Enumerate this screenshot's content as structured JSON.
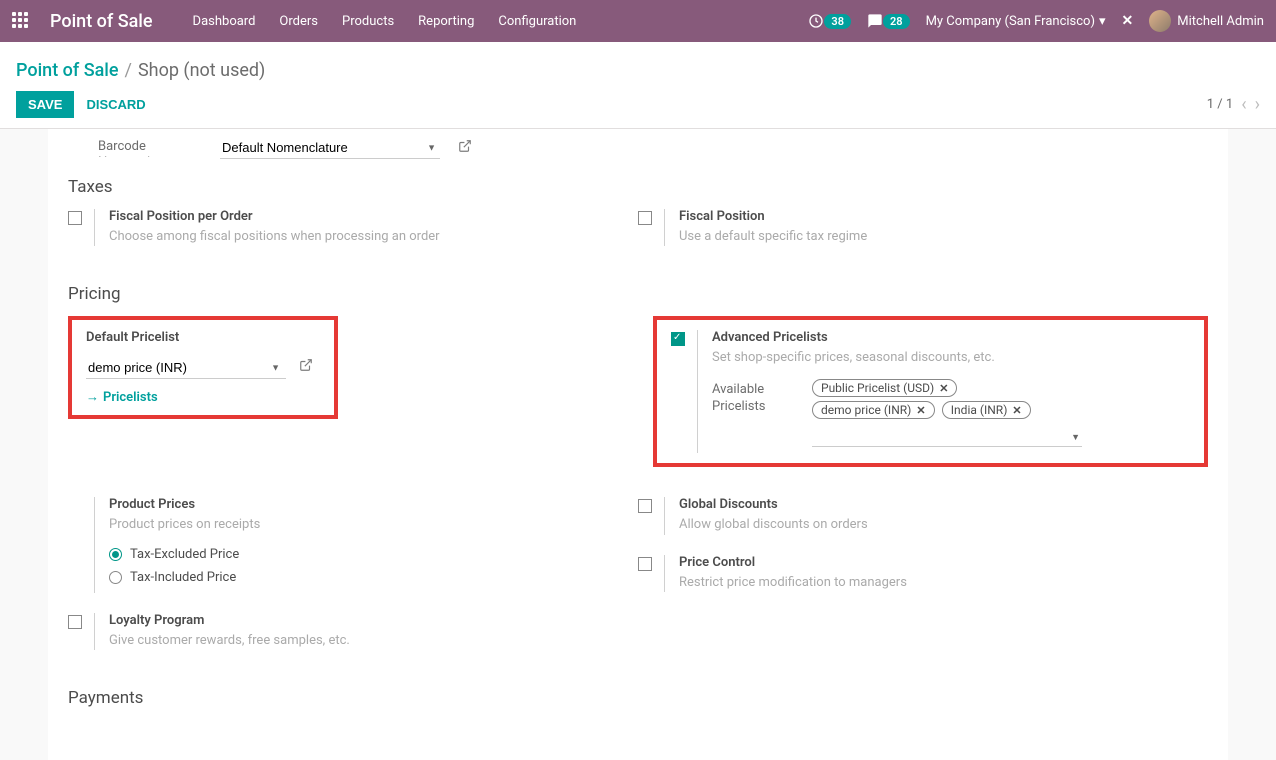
{
  "nav": {
    "brand": "Point of Sale",
    "items": [
      "Dashboard",
      "Orders",
      "Products",
      "Reporting",
      "Configuration"
    ],
    "activity_count": "38",
    "message_count": "28",
    "company": "My Company (San Francisco)",
    "user": "Mitchell Admin"
  },
  "breadcrumbs": {
    "root": "Point of Sale",
    "current": "Shop (not used)"
  },
  "actions": {
    "save": "SAVE",
    "discard": "DISCARD"
  },
  "pager": {
    "text": "1 / 1"
  },
  "top_field": {
    "label": "Barcode Nomenclature",
    "value": "Default Nomenclature"
  },
  "sections": {
    "taxes": "Taxes",
    "pricing": "Pricing",
    "payments": "Payments"
  },
  "taxes": {
    "fiscal_per_order": {
      "title": "Fiscal Position per Order",
      "desc": "Choose among fiscal positions when processing an order"
    },
    "fiscal_position": {
      "title": "Fiscal Position",
      "desc": "Use a default specific tax regime"
    }
  },
  "pricing": {
    "default_pricelist": {
      "title": "Default Pricelist",
      "value": "demo price (INR)",
      "link": "Pricelists"
    },
    "product_prices": {
      "title": "Product Prices",
      "desc": "Product prices on receipts",
      "opt1": "Tax-Excluded Price",
      "opt2": "Tax-Included Price"
    },
    "loyalty": {
      "title": "Loyalty Program",
      "desc": "Give customer rewards, free samples, etc."
    },
    "advanced": {
      "title": "Advanced Pricelists",
      "desc": "Set shop-specific prices, seasonal discounts, etc.",
      "field_label": "Available Pricelists",
      "tags": [
        "Public Pricelist (USD)",
        "demo price (INR)",
        "India (INR)"
      ]
    },
    "global_discounts": {
      "title": "Global Discounts",
      "desc": "Allow global discounts on orders"
    },
    "price_control": {
      "title": "Price Control",
      "desc": "Restrict price modification to managers"
    }
  }
}
